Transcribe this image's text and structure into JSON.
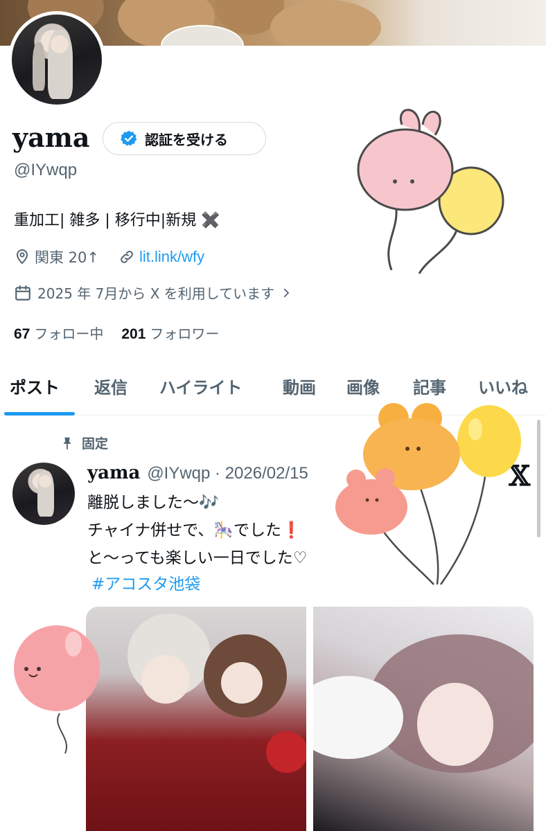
{
  "profile": {
    "name": "yama",
    "handle": "@IYwqp",
    "verify_button": "認証を受ける",
    "bio": "重加工| 雑多 | 移行中|新規 ✖️",
    "location": "関東 20↑",
    "link": "lit.link/wfy",
    "joined": "2025 年 7月から X を利用しています",
    "following_count": "67",
    "following_label": "フォロー中",
    "followers_count": "201",
    "followers_label": "フォロワー"
  },
  "tabs": [
    "ポスト",
    "返信",
    "ハイライト",
    "動画",
    "画像",
    "記事",
    "いいね"
  ],
  "active_tab": 0,
  "post": {
    "pinned_label": "固定",
    "author": "yama",
    "handle_date": "@IYwqp · 2026/02/15",
    "lines": [
      "離脱しました〜🎶",
      "チャイナ併せで、🎠でした❗️",
      "と〜っても楽しい一日でした♡"
    ],
    "hashtag": "#アコスタ池袋"
  },
  "colors": {
    "accent": "#1d9bf0",
    "text_primary": "#0f1419",
    "text_secondary": "#536471"
  },
  "icons": [
    "verified-badge-icon",
    "location-pin-icon",
    "link-icon",
    "calendar-icon",
    "chevron-right-icon",
    "pin-icon",
    "x-logo-icon",
    "balloon-sticker-icon"
  ]
}
